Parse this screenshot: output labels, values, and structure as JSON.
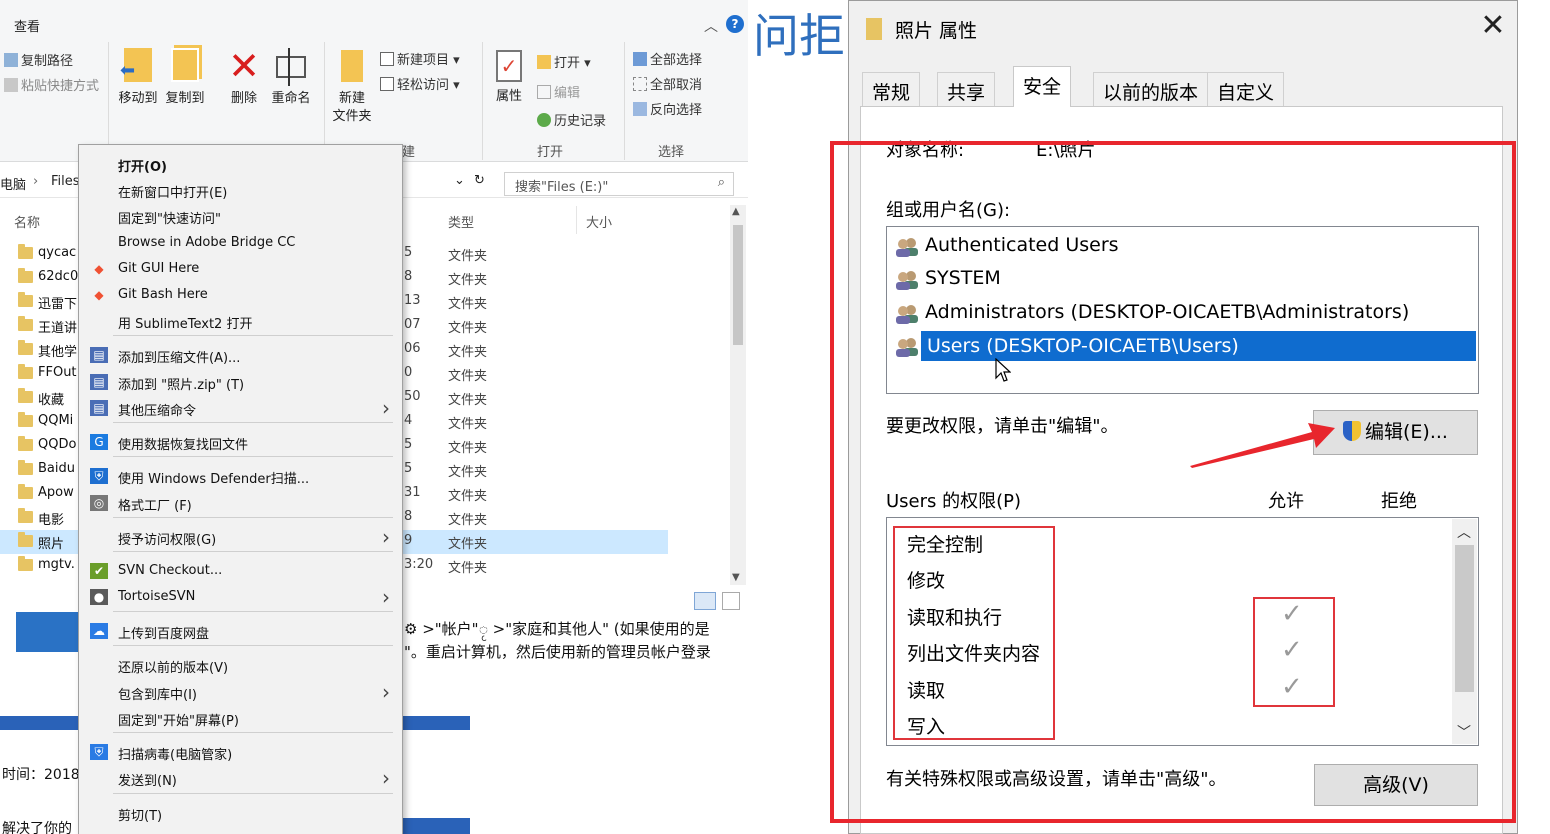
{
  "explorer": {
    "top_tab": "查看",
    "ribbon": {
      "copy_path": "复制路径",
      "paste_shortcut": "粘贴快捷方式",
      "move_to": "移动到",
      "copy_to": "复制到",
      "delete": "删除",
      "rename": "重命名",
      "new_folder_line1": "新建",
      "new_folder_line2": "文件夹",
      "new_item": "新建项目",
      "easy_access": "轻松访问",
      "properties": "属性",
      "open": "打开",
      "edit": "编辑",
      "history": "历史记录",
      "select_all": "全部选择",
      "select_none": "全部取消",
      "invert_selection": "反向选择",
      "group_new_fragment": "建",
      "group_open": "打开",
      "group_select": "选择"
    },
    "breadcrumb": {
      "part1": "电脑",
      "part2": "Files"
    },
    "search_placeholder": "搜索\"Files (E:)\"",
    "columns": {
      "name": "名称",
      "type": "类型",
      "size": "大小"
    },
    "files": [
      {
        "name": "qycac",
        "num": "5",
        "type": "文件夹"
      },
      {
        "name": "62dc0",
        "num": "8",
        "type": "文件夹"
      },
      {
        "name": "迅雷下",
        "num": "13",
        "type": "文件夹"
      },
      {
        "name": "王道讲",
        "num": "07",
        "type": "文件夹"
      },
      {
        "name": "其他学",
        "num": "06",
        "type": "文件夹"
      },
      {
        "name": "FFOut",
        "num": "0",
        "type": "文件夹"
      },
      {
        "name": "收藏",
        "num": "50",
        "type": "文件夹"
      },
      {
        "name": "QQMi",
        "num": "4",
        "type": "文件夹"
      },
      {
        "name": "QQDo",
        "num": "5",
        "type": "文件夹"
      },
      {
        "name": "Baidu",
        "num": "5",
        "type": "文件夹"
      },
      {
        "name": "Apow",
        "num": "31",
        "type": "文件夹"
      },
      {
        "name": "电影",
        "num": "8",
        "type": "文件夹"
      },
      {
        "name": "照片",
        "num": "9",
        "type": "文件夹"
      },
      {
        "name": "mgtv.",
        "num": "3:20",
        "type": "文件夹"
      }
    ],
    "body_line1": "⚙ >\"帐户\"ႂ >\"家庭和其他人\" (如果使用的是",
    "body_line2": "\"。重启计算机，然后使用新的管理员帐户登录",
    "time_label": "时间：2018",
    "bottom_text": "解决了你的"
  },
  "context_menu": {
    "items": [
      {
        "label": "打开(O)",
        "bold": true
      },
      {
        "label": "在新窗口中打开(E)"
      },
      {
        "label": "固定到\"快速访问\""
      },
      {
        "label": "Browse in Adobe Bridge CC"
      },
      {
        "label": "Git GUI Here"
      },
      {
        "label": "Git Bash Here"
      },
      {
        "label": "用 SublimeText2 打开"
      },
      {
        "label": "添加到压缩文件(A)..."
      },
      {
        "label": "添加到 \"照片.zip\" (T)"
      },
      {
        "label": "其他压缩命令"
      },
      {
        "label": "使用数据恢复找回文件"
      },
      {
        "label": "使用 Windows Defender扫描..."
      },
      {
        "label": "格式工厂 (F)"
      },
      {
        "label": "授予访问权限(G)"
      },
      {
        "label": "SVN Checkout..."
      },
      {
        "label": "TortoiseSVN"
      },
      {
        "label": "上传到百度网盘"
      },
      {
        "label": "还原以前的版本(V)"
      },
      {
        "label": "包含到库中(I)"
      },
      {
        "label": "固定到\"开始\"屏幕(P)"
      },
      {
        "label": "扫描病毒(电脑管家)"
      },
      {
        "label": "发送到(N)"
      },
      {
        "label": "剪切(T)"
      }
    ]
  },
  "background_title": "问拒",
  "dialog": {
    "title": "照片 属性",
    "close_glyph": "✕",
    "tabs": [
      "常规",
      "共享",
      "安全",
      "以前的版本",
      "自定义"
    ],
    "active_tab": "安全",
    "object_name_label": "对象名称:",
    "object_name_value": "E:\\照片",
    "groups_label": "组或用户名(G):",
    "users": [
      "Authenticated Users",
      "SYSTEM",
      "Administrators (DESKTOP-OICAETB\\Administrators)",
      "Users (DESKTOP-OICAETB\\Users)"
    ],
    "selected_user_index": 3,
    "change_hint": "要更改权限，请单击\"编辑\"。",
    "edit_button": "编辑(E)...",
    "permissions_label": "Users 的权限(P)",
    "allow_header": "允许",
    "deny_header": "拒绝",
    "permissions": [
      "完全控制",
      "修改",
      "读取和执行",
      "列出文件夹内容",
      "读取",
      "写入"
    ],
    "allowed": [
      false,
      false,
      true,
      true,
      true,
      false
    ],
    "advanced_hint": "有关特殊权限或高级设置，请单击\"高级\"。",
    "advanced_button": "高级(V)"
  },
  "colors": {
    "selection_blue": "#0f6ccf",
    "annotation_red": "#e8262d",
    "title_blue": "#2f6fbd"
  }
}
